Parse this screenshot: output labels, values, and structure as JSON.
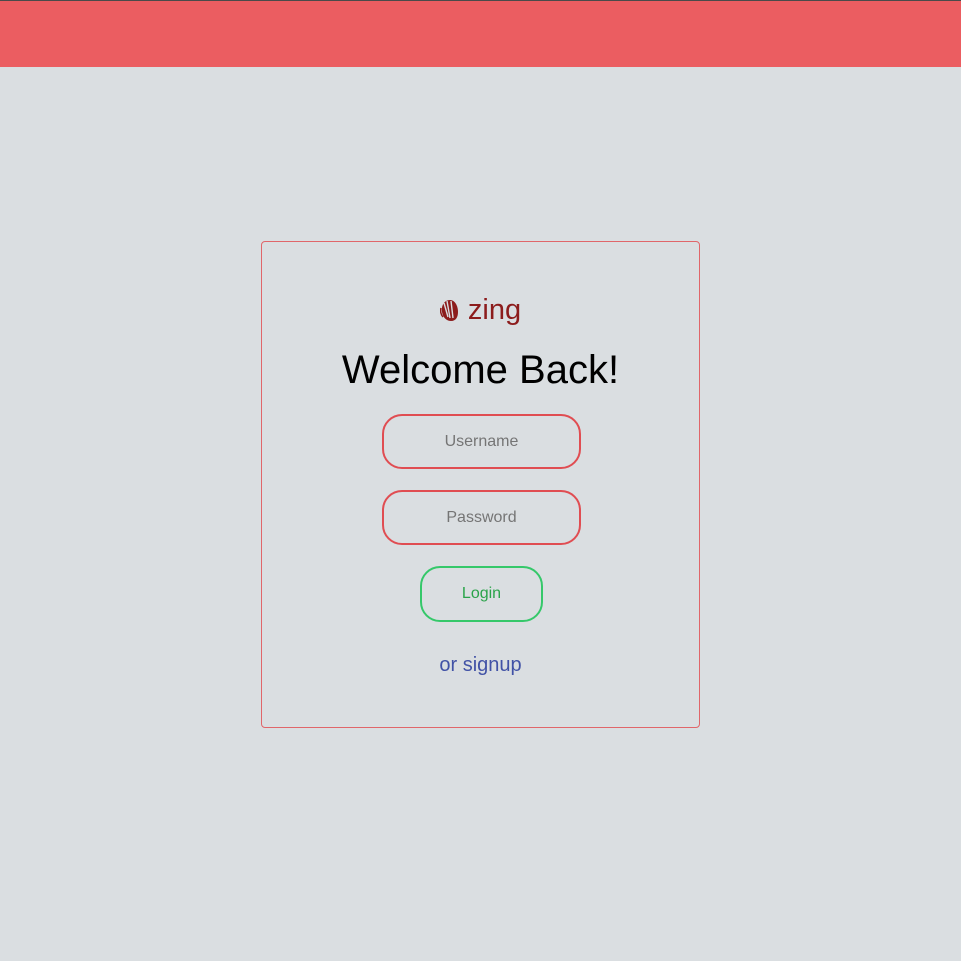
{
  "header": {
    "color": "#eb5d61"
  },
  "login_card": {
    "brand": {
      "icon": "shell-logo-icon",
      "name": "zing",
      "color": "#8c1c1c"
    },
    "title": "Welcome Back!",
    "username": {
      "placeholder": "Username",
      "value": ""
    },
    "password": {
      "placeholder": "Password",
      "value": ""
    },
    "login_label": "Login",
    "signup_label": "or signup"
  },
  "colors": {
    "background": "#dadee1",
    "input_border": "#e04d52",
    "login_border": "#35c86a",
    "login_text": "#2aa34a",
    "link": "#4152a6"
  }
}
